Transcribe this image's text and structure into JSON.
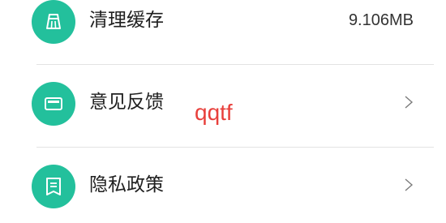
{
  "settings_list": {
    "items": [
      {
        "icon": "broom-icon",
        "label": "清理缓存",
        "value": "9.106MB"
      },
      {
        "icon": "message-icon",
        "label": "意见反馈",
        "trailing": "chevron-right-icon"
      },
      {
        "icon": "document-icon",
        "label": "隐私政策",
        "trailing": "chevron-right-icon"
      }
    ]
  },
  "overlay_text": "qqtf",
  "colors": {
    "accent": "#23c09c",
    "overlay_text": "#e8403c",
    "divider": "#e3e3e3"
  }
}
